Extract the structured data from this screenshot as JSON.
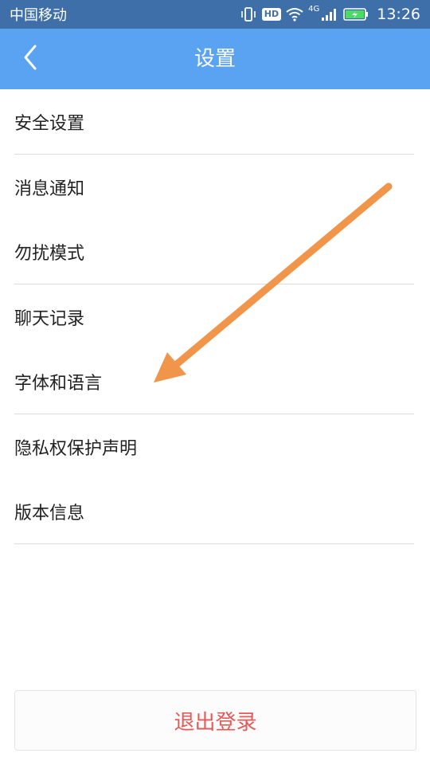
{
  "status_bar": {
    "carrier": "中国移动",
    "network_label": "4G",
    "hd_label": "HD",
    "time": "13:26"
  },
  "header": {
    "title": "设置",
    "back_icon": "chevron-left-icon"
  },
  "menu": {
    "items": [
      {
        "label": "安全设置"
      },
      {
        "label": "消息通知"
      },
      {
        "label": "勿扰模式"
      },
      {
        "label": "聊天记录"
      },
      {
        "label": "字体和语言"
      },
      {
        "label": "隐私权保护声明"
      },
      {
        "label": "版本信息"
      }
    ]
  },
  "logout": {
    "label": "退出登录"
  },
  "colors": {
    "status_bar": "#3f6fa9",
    "header": "#5aa2f2",
    "logout_text": "#e55a56",
    "arrow": "#f0954a"
  }
}
